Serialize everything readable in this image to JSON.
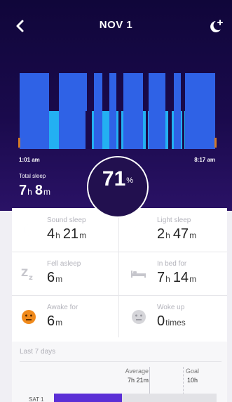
{
  "header": {
    "date": "NOV 1",
    "back_icon": "chevron-left-icon",
    "night_icon": "moon-plus-icon"
  },
  "graph": {
    "start_time": "1:01 am",
    "end_time": "8:17 am",
    "colors": {
      "sound": "#2f62e6",
      "light": "#23b0f2"
    }
  },
  "total": {
    "label": "Total sleep",
    "hours": "7",
    "hours_unit": "h",
    "minutes": "8",
    "minutes_unit": "m"
  },
  "score": {
    "value": "71",
    "unit": "%"
  },
  "stats": {
    "sound": {
      "label": "Sound sleep",
      "v1": "4",
      "u1": "h",
      "v2": "21",
      "u2": "m",
      "icon": "moon-icon"
    },
    "light": {
      "label": "Light sleep",
      "v1": "2",
      "u1": "h",
      "v2": "47",
      "u2": "m",
      "icon": "moon-icon"
    },
    "fell": {
      "label": "Fell asleep",
      "v1": "6",
      "u1": "m",
      "icon": "zz-icon"
    },
    "inbed": {
      "label": "In bed for",
      "v1": "7",
      "u1": "h",
      "v2": "14",
      "u2": "m",
      "icon": "bed-icon"
    },
    "awake": {
      "label": "Awake for",
      "v1": "6",
      "u1": "m",
      "icon": "awake-face-icon"
    },
    "woke": {
      "label": "Woke up",
      "v1": "0",
      "u1": "times",
      "icon": "neutral-face-icon"
    }
  },
  "week": {
    "label": "Last 7 days",
    "average_label": "Average",
    "average_value": "7h 21m",
    "goal_label": "Goal",
    "goal_value": "10h",
    "days": [
      {
        "label": "SAT 1",
        "fraction": 0.42
      }
    ],
    "bar_color": "#5b2fd6"
  }
}
